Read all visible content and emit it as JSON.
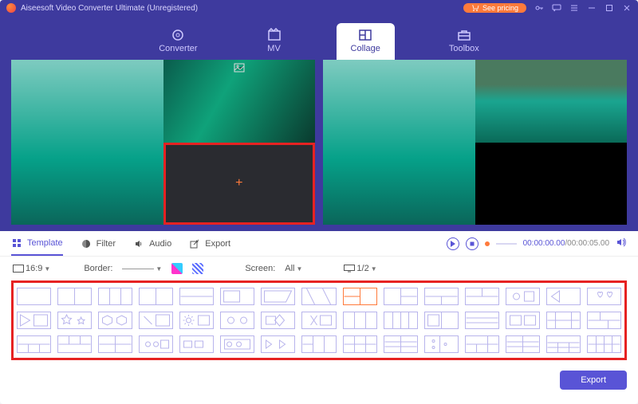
{
  "titlebar": {
    "app_title": "Aiseesoft Video Converter Ultimate (Unregistered)",
    "pricing_label": "See pricing"
  },
  "main_tabs": {
    "converter": "Converter",
    "mv": "MV",
    "collage": "Collage",
    "toolbox": "Toolbox",
    "active": "collage"
  },
  "sub_tabs": {
    "template": "Template",
    "filter": "Filter",
    "audio": "Audio",
    "export": "Export",
    "active": "template"
  },
  "playback": {
    "current_time": "00:00:00.00",
    "duration": "00:00:05.00"
  },
  "options": {
    "ratio_icon": "ratio-icon",
    "ratio_value": "16:9",
    "border_label": "Border:",
    "screen_label": "Screen:",
    "screen_value": "All",
    "split_value": "1/2"
  },
  "template_grid": {
    "selected_index": 8,
    "count": 45
  },
  "footer": {
    "export_label": "Export"
  },
  "icons": {
    "plus": "+"
  }
}
